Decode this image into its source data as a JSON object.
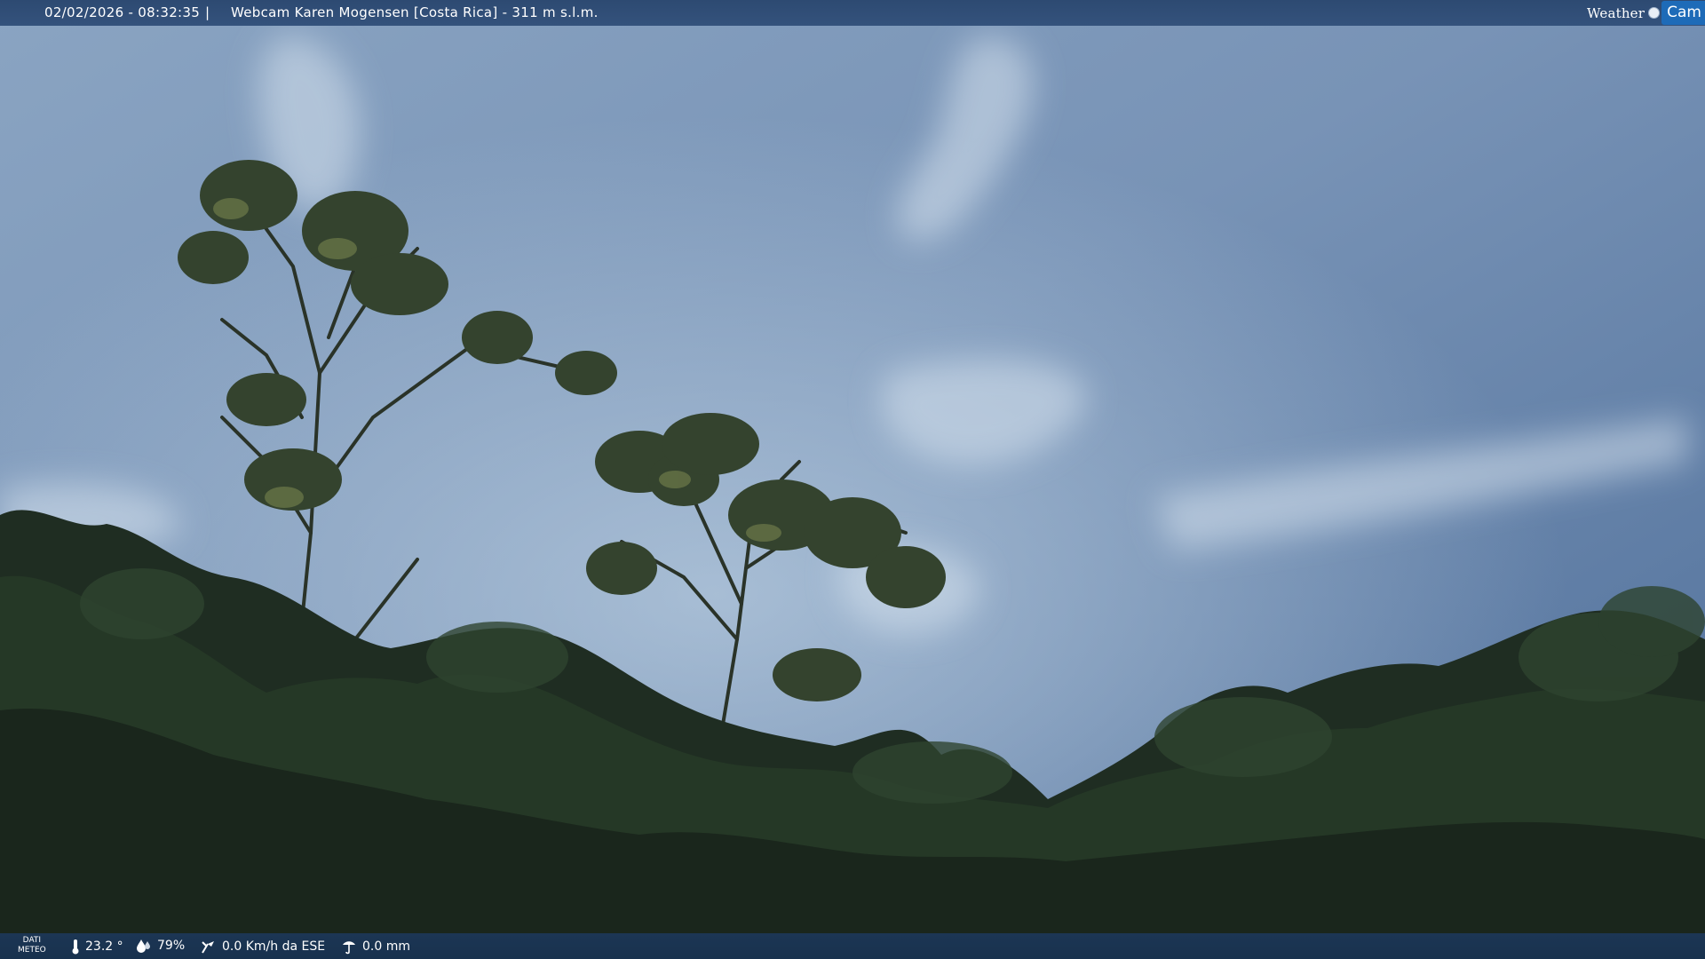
{
  "header": {
    "timestamp": "02/02/2026 - 08:32:35",
    "separator": "|",
    "title": "Webcam Karen Mogensen [Costa Rica] - 311 m s.l.m.",
    "brand_weather": "Weather",
    "brand_cam": "Cam"
  },
  "footer": {
    "dati_line1": "DATI",
    "dati_line2": "METEO",
    "temperature": "23.2 °",
    "humidity": "79%",
    "wind": "0.0 Km/h da ESE",
    "rain": "0.0 mm"
  },
  "icons": {
    "temperature": "thermometer-icon",
    "humidity": "humidity-drop-icon",
    "wind": "wind-icon",
    "rain": "rain-gauge-icon"
  },
  "colors": {
    "header_bg": "#2d4a72",
    "footer_bg": "#1c3654",
    "brand_accent": "#1e6bb8",
    "sky": "#6f8fb3",
    "foliage": "#1c2a1e"
  }
}
